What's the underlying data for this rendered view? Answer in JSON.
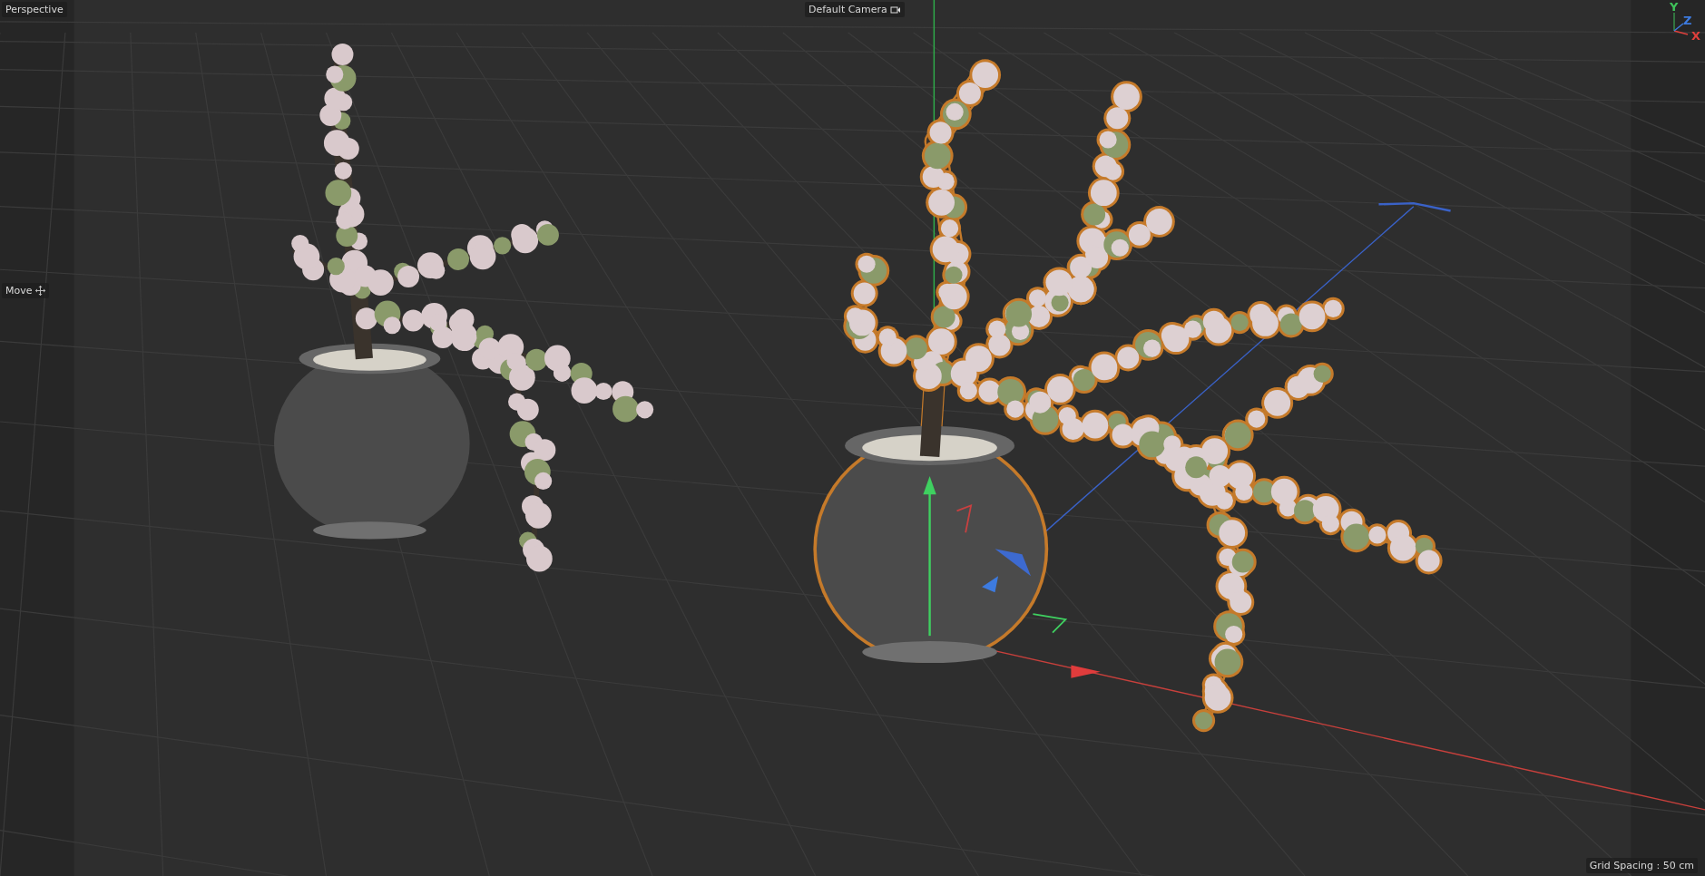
{
  "viewport": {
    "view_name": "Perspective",
    "camera": "Default Camera",
    "tool": "Move",
    "grid_spacing": "Grid Spacing : 50 cm"
  },
  "axis_gizmo": {
    "labels": [
      {
        "text": "Y",
        "color": "#3fc25a"
      },
      {
        "text": "Z",
        "color": "#3d7be0"
      },
      {
        "text": "X",
        "color": "#e0403c"
      }
    ]
  }
}
